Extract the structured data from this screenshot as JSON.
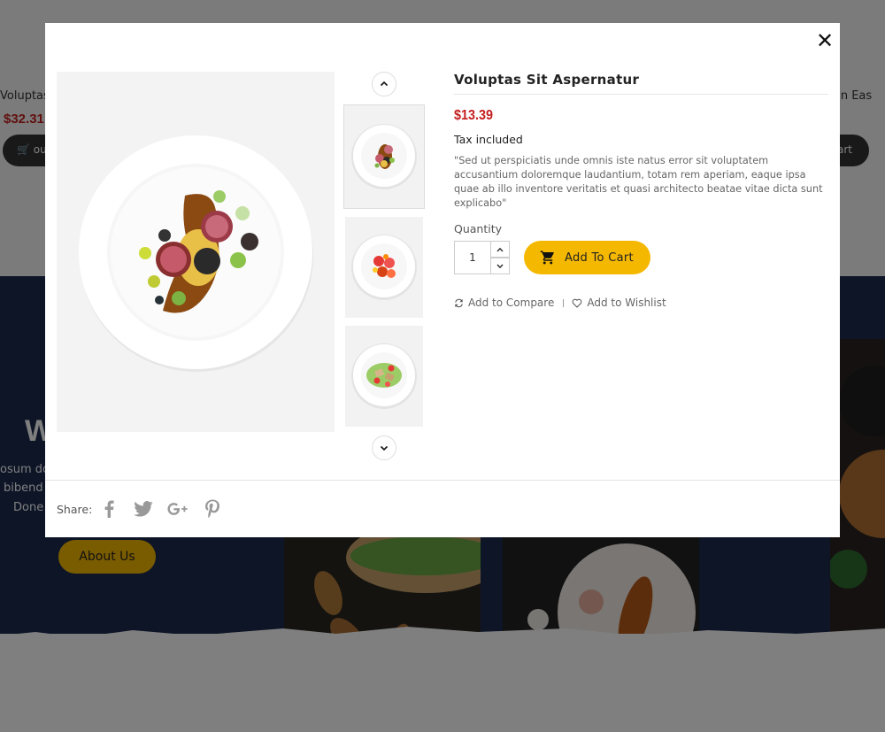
{
  "background": {
    "product_left": {
      "name": "Voluptas I",
      "price": "$32.31",
      "cart_label": "ou"
    },
    "product_right": {
      "name": "ui In Eas",
      "cart_label": "art"
    },
    "welcome_heading": "W",
    "text_lines": [
      "osum do",
      "bibend",
      "Done"
    ],
    "about_button": "About Us"
  },
  "modal": {
    "close_glyph": "✕",
    "product": {
      "title": "Voluptas Sit Aspernatur",
      "price": "$13.39",
      "tax_note": "Tax included",
      "description": "\"Sed ut perspiciatis unde omnis iste natus error sit voluptatem accusantium doloremque laudantium, totam rem aperiam, eaque ipsa quae ab illo inventore veritatis et quasi architecto beatae vitae dicta sunt explicabo\"",
      "quantity_label": "Quantity",
      "quantity_value": "1",
      "add_to_cart": "Add To Cart",
      "add_to_compare": "Add to Compare",
      "add_to_wishlist": "Add to Wishlist"
    },
    "gallery": {
      "thumbnails": [
        "plated-fine-dining",
        "tomato-salad",
        "chicken-salad"
      ],
      "active_index": 0
    },
    "share": {
      "label": "Share:",
      "networks": [
        "facebook-icon",
        "twitter-icon",
        "google-plus-icon",
        "pinterest-icon"
      ]
    }
  },
  "colors": {
    "accent": "#f5b800",
    "price": "#c41e1e",
    "navy": "#1b2b4e"
  }
}
